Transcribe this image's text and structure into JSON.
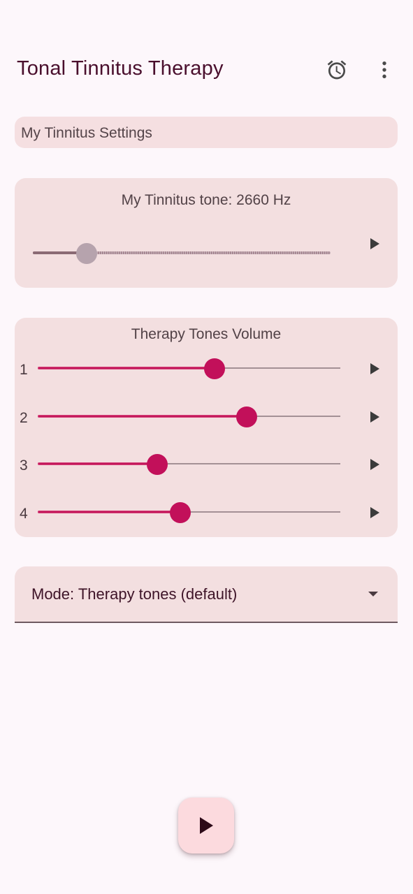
{
  "app": {
    "title": "Tonal Tinnitus Therapy",
    "icons": {
      "alarm": "alarm-clock-icon",
      "more": "more-vert-icon"
    }
  },
  "settings": {
    "label": "My Tinnitus Settings"
  },
  "tone": {
    "label": "My Tinnitus tone: 2660 Hz",
    "slider_fraction": 0.18,
    "play_icon": "play-icon"
  },
  "therapy": {
    "title": "Therapy Tones Volume",
    "rows": [
      {
        "number": "1",
        "fraction": 0.585
      },
      {
        "number": "2",
        "fraction": 0.69
      },
      {
        "number": "3",
        "fraction": 0.395
      },
      {
        "number": "4",
        "fraction": 0.47
      }
    ]
  },
  "mode": {
    "label": "Mode: Therapy tones (default)",
    "icon": "dropdown-arrow-icon"
  },
  "fab": {
    "icon": "play-icon"
  },
  "colors": {
    "background": "#fdf7fb",
    "card": "#f3dfe0",
    "accent": "#c2105a",
    "title": "#4a0f2d"
  }
}
